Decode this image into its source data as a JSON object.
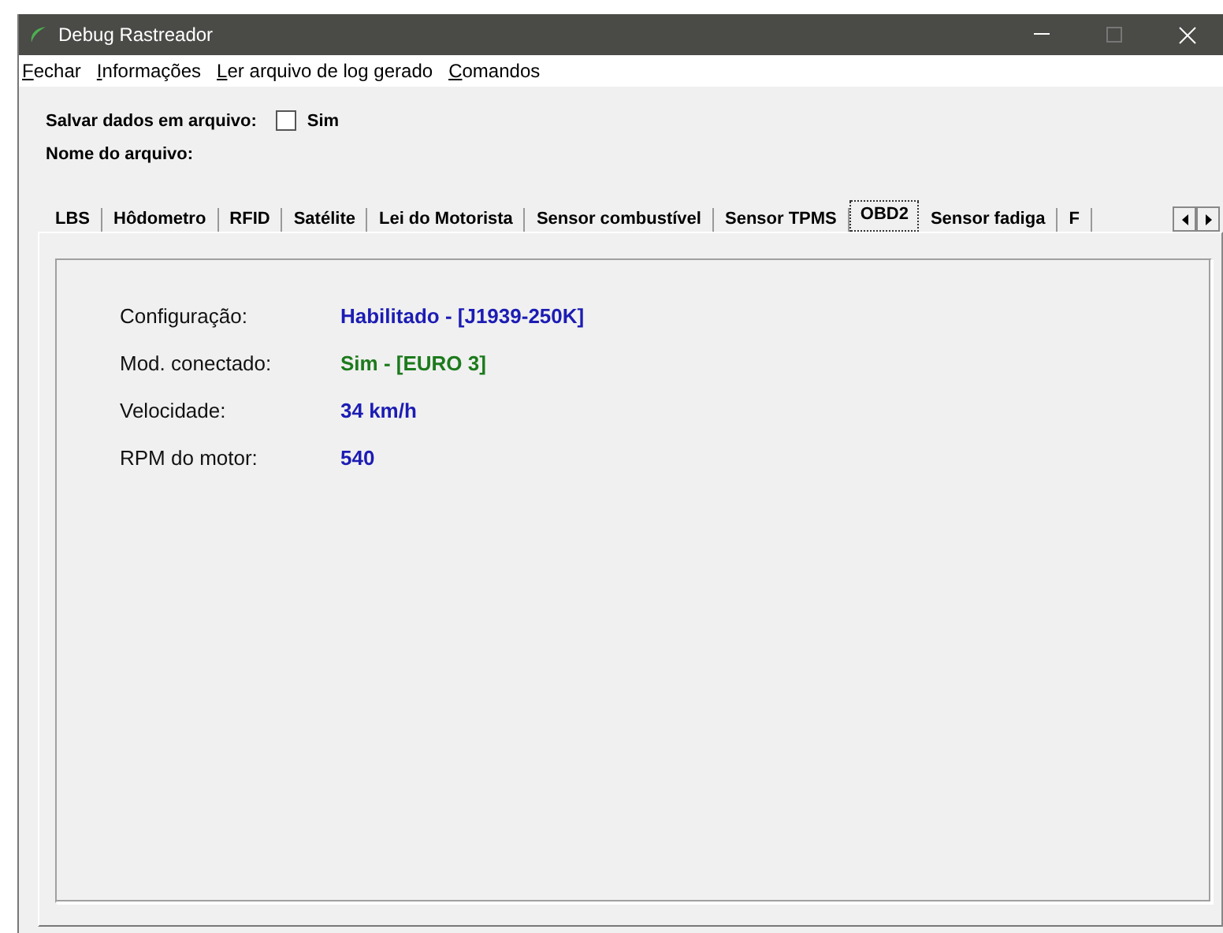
{
  "window": {
    "title": "Debug Rastreador"
  },
  "menu": [
    {
      "label": "Fechar"
    },
    {
      "label": "Informações"
    },
    {
      "label": "Ler arquivo de log gerado"
    },
    {
      "label": "Comandos"
    }
  ],
  "save_to_file": {
    "label": "Salvar dados em arquivo:",
    "option": "Sim",
    "checked": false
  },
  "file_name": {
    "label": "Nome do arquivo:"
  },
  "tabs": [
    {
      "label": "LBS",
      "selected": false
    },
    {
      "label": "Hôdometro",
      "selected": false
    },
    {
      "label": "RFID",
      "selected": false
    },
    {
      "label": "Satélite",
      "selected": false
    },
    {
      "label": "Lei do Motorista",
      "selected": false
    },
    {
      "label": "Sensor combustível",
      "selected": false
    },
    {
      "label": "Sensor TPMS",
      "selected": false
    },
    {
      "label": "OBD2",
      "selected": true
    },
    {
      "label": "Sensor fadiga",
      "selected": false
    },
    {
      "label": "F",
      "selected": false
    }
  ],
  "fields": [
    {
      "label": "Configuração:",
      "value": "Habilitado - [J1939-250K]",
      "color": "#1c1cb4"
    },
    {
      "label": "Mod. conectado:",
      "value": "Sim - [EURO 3]",
      "color": "#1c7a1c"
    },
    {
      "label": "Velocidade:",
      "value": "34 km/h",
      "color": "#1c1cb4"
    },
    {
      "label": "RPM do motor:",
      "value": "540",
      "color": "#1c1cb4"
    }
  ]
}
